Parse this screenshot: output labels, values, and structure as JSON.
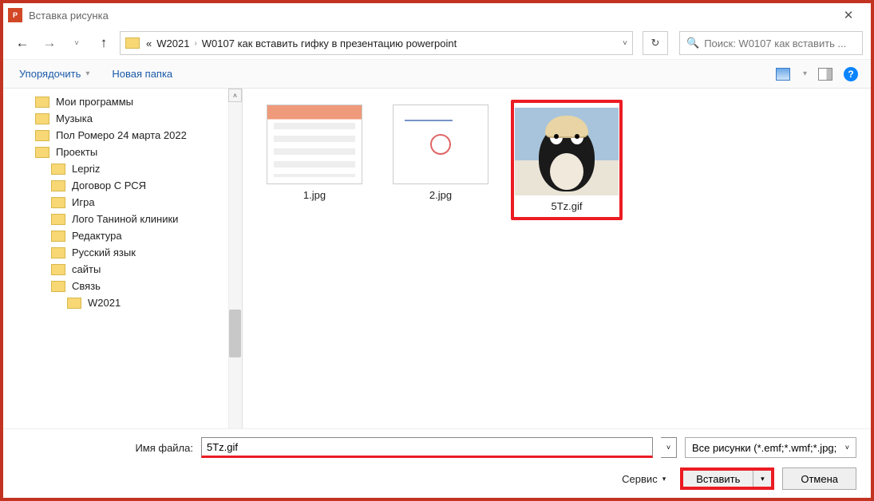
{
  "title": "Вставка рисунка",
  "breadcrumb": {
    "prefix": "«",
    "items": [
      "W2021",
      "W0107 как вставить гифку в презентацию powerpoint"
    ]
  },
  "search": {
    "placeholder": "Поиск: W0107 как вставить ..."
  },
  "toolbar": {
    "organize": "Упорядочить",
    "newFolder": "Новая папка"
  },
  "tree": [
    {
      "label": "Мои программы",
      "depth": 1
    },
    {
      "label": "Музыка",
      "depth": 1
    },
    {
      "label": "Пол Ромеро 24 марта 2022",
      "depth": 1
    },
    {
      "label": "Проекты",
      "depth": 1
    },
    {
      "label": "Lepriz",
      "depth": 2
    },
    {
      "label": "Договор С РСЯ",
      "depth": 2
    },
    {
      "label": "Игра",
      "depth": 2
    },
    {
      "label": "Лого Таниной клиники",
      "depth": 2
    },
    {
      "label": "Редактура",
      "depth": 2
    },
    {
      "label": "Русский язык",
      "depth": 2
    },
    {
      "label": "сайты",
      "depth": 2
    },
    {
      "label": "Связь",
      "depth": 2
    },
    {
      "label": "W2021",
      "depth": 3
    }
  ],
  "files": [
    {
      "name": "1.jpg",
      "thumb": "ppt",
      "selected": false
    },
    {
      "name": "2.jpg",
      "thumb": "slide",
      "selected": false
    },
    {
      "name": "5Tz.gif",
      "thumb": "penguin",
      "selected": true
    }
  ],
  "bottom": {
    "filenameLabel": "Имя файла:",
    "filenameValue": "5Tz.gif",
    "filetype": "Все рисунки (*.emf;*.wmf;*.jpg;",
    "service": "Сервис",
    "insert": "Вставить",
    "cancel": "Отмена"
  }
}
